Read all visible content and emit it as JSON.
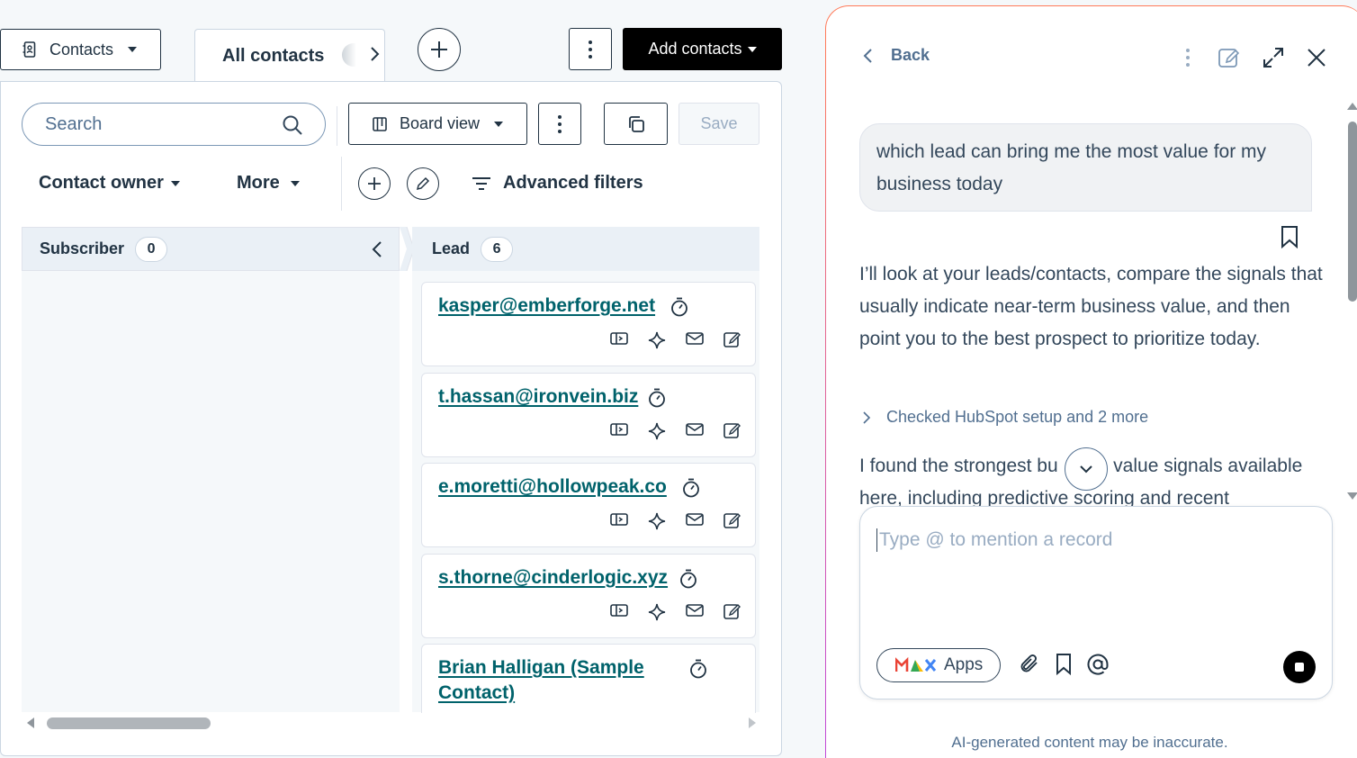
{
  "toolbar": {
    "object_selector": "Contacts",
    "active_tab": "All contacts",
    "add_contacts": "Add contacts"
  },
  "board_controls": {
    "search_placeholder": "Search",
    "view_selector": "Board view",
    "save": "Save",
    "contact_owner": "Contact owner",
    "more": "More",
    "advanced_filters": "Advanced filters"
  },
  "columns": [
    {
      "name": "Subscriber",
      "count": "0"
    },
    {
      "name": "Lead",
      "count": "6"
    }
  ],
  "cards": [
    {
      "name": "kasper@emberforge.net"
    },
    {
      "name": "t.hassan@ironvein.biz"
    },
    {
      "name": "e.moretti@hollowpeak.co"
    },
    {
      "name": "s.thorne@cinderlogic.xyz"
    },
    {
      "name_line1": "Brian Halligan (Sample",
      "name_line2": "Contact)"
    }
  ],
  "assistant": {
    "back": "Back",
    "user_message": "which lead can bring me the most value for my business today",
    "ai_intro": "I’ll look at your leads/contacts, compare the signals that usually indicate near-term business value, and then point you to the best prospect to prioritize today.",
    "checked": "Checked HubSpot setup and 2 more",
    "ai_partial_a": "I found the strongest bu",
    "ai_partial_b": "n value signals available",
    "ai_partial_c": "here, including predictive scoring and recent",
    "composer_placeholder": "Type @ to mention a record",
    "apps": "Apps",
    "disclaimer": "AI-generated content may be inaccurate."
  },
  "colors": {
    "accent_link": "#00626b",
    "panel_border_top": "#ff7a59",
    "panel_border_bottom": "#c046d9",
    "dark_button": "#000000"
  }
}
